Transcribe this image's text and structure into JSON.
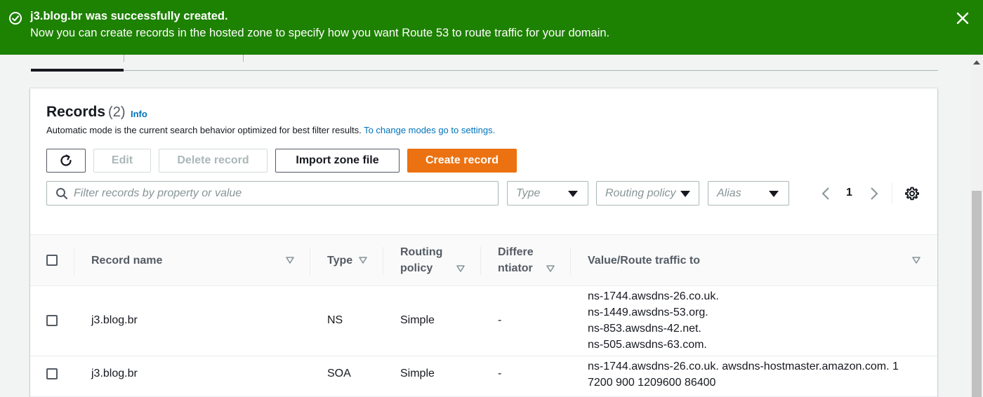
{
  "flash": {
    "title": "j3.blog.br was successfully created.",
    "message": "Now you can create records in the hosted zone to specify how you want Route 53 to route traffic for your domain.",
    "color": "#1d8102"
  },
  "records": {
    "title": "Records",
    "count": "(2)",
    "info_label": "Info",
    "description": "Automatic mode is the current search behavior optimized for best filter results. ",
    "description_link": "To change modes go to settings."
  },
  "toolbar": {
    "edit_label": "Edit",
    "delete_label": "Delete record",
    "import_label": "Import zone file",
    "create_label": "Create record",
    "primary_color": "#ec7211"
  },
  "filters": {
    "search_placeholder": "Filter records by property or value",
    "type_placeholder": "Type",
    "routing_placeholder": "Routing policy",
    "alias_placeholder": "Alias"
  },
  "pagination": {
    "current_page": "1"
  },
  "table": {
    "columns": {
      "record_name": "Record name",
      "type": "Type",
      "routing_line1": "Routing",
      "routing_line2": "policy",
      "diff_line1": "Differe",
      "diff_line2": "ntiator",
      "value": "Value/Route traffic to"
    },
    "rows": [
      {
        "name": "j3.blog.br",
        "type": "NS",
        "routing": "Simple",
        "differentiator": "-",
        "values": [
          "ns-1744.awsdns-26.co.uk.",
          "ns-1449.awsdns-53.org.",
          "ns-853.awsdns-42.net.",
          "ns-505.awsdns-63.com."
        ]
      },
      {
        "name": "j3.blog.br",
        "type": "SOA",
        "routing": "Simple",
        "differentiator": "-",
        "values": [
          "ns-1744.awsdns-26.co.uk. awsdns-hostmaster.amazon.com. 1",
          "7200 900 1209600 86400"
        ]
      }
    ]
  }
}
